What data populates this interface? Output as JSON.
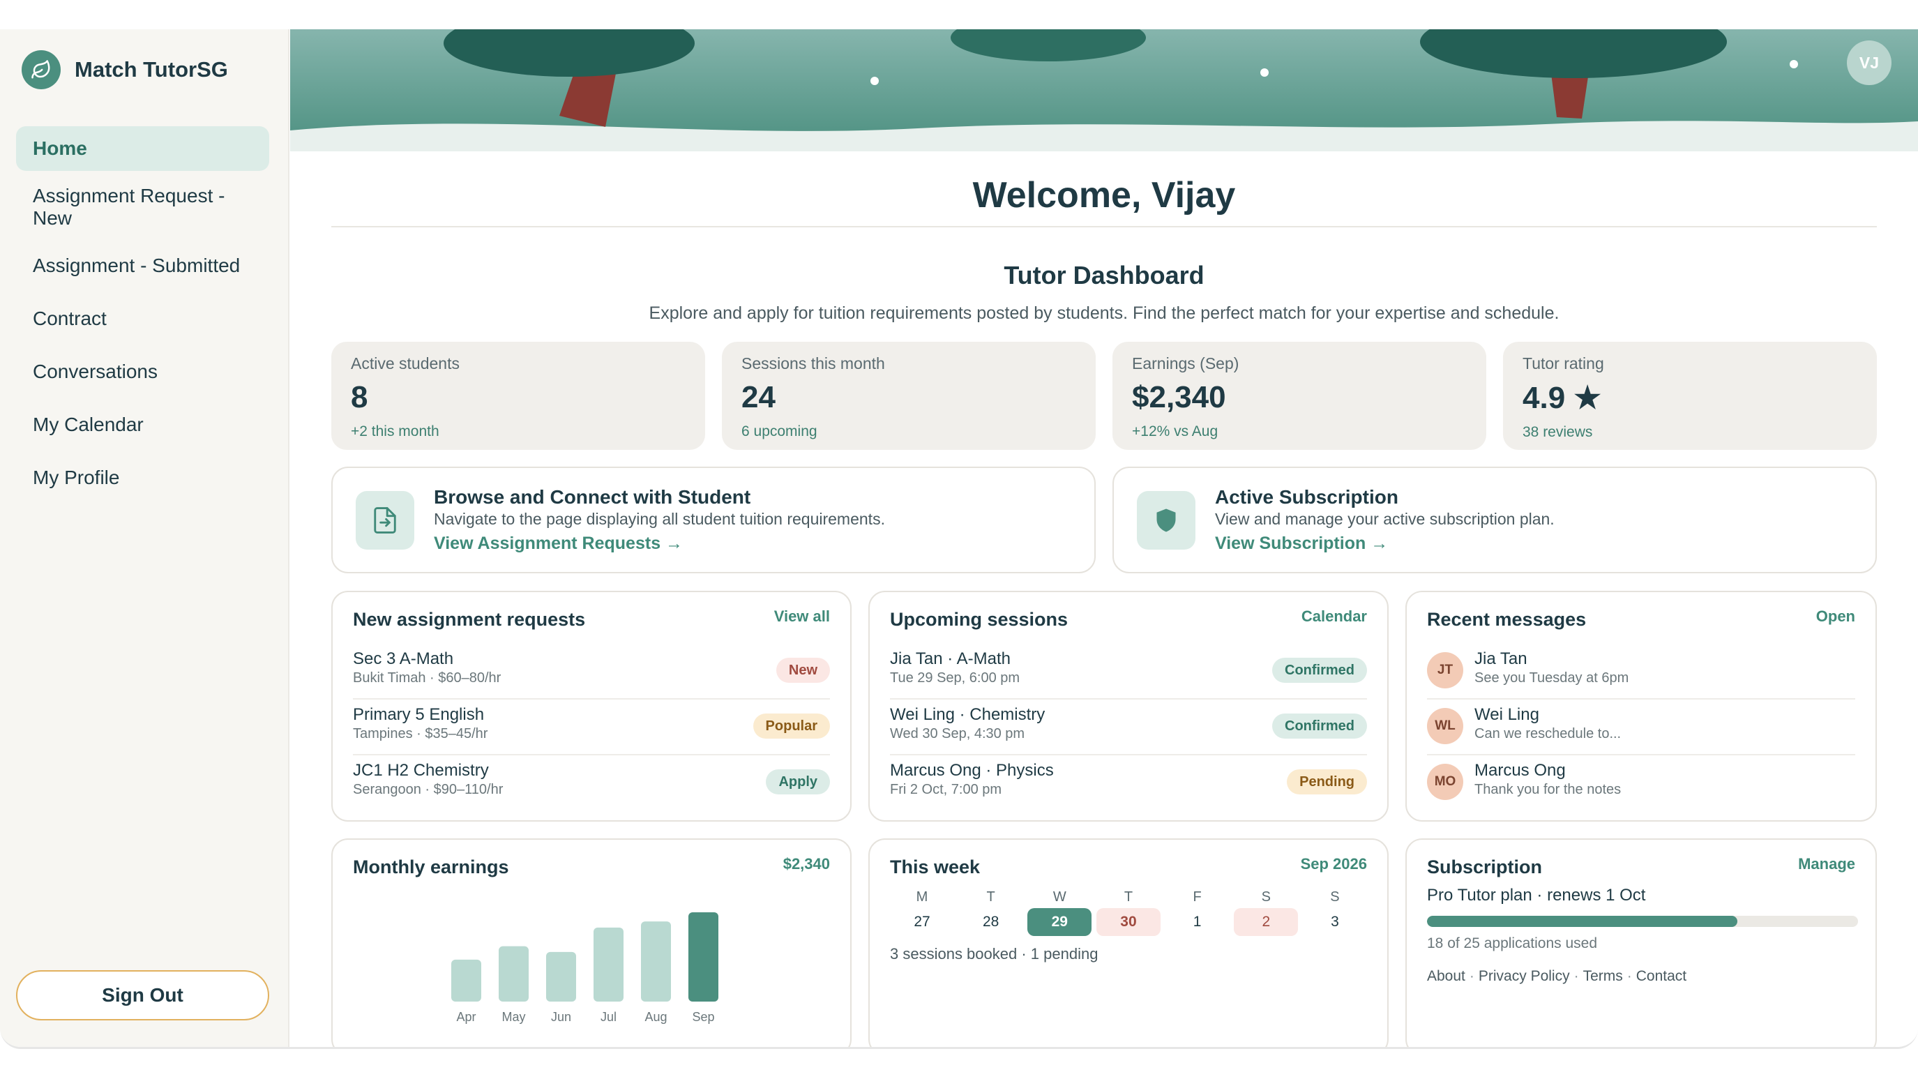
{
  "brand": {
    "name": "Match TutorSG",
    "icon": "leaf-icon"
  },
  "nav": {
    "items": [
      {
        "label": "Home",
        "active": true
      },
      {
        "label": "Assignment Request - New",
        "active": false
      },
      {
        "label": "Assignment - Submitted",
        "active": false
      },
      {
        "label": "Contract",
        "active": false
      },
      {
        "label": "Conversations",
        "active": false
      },
      {
        "label": "My Calendar",
        "active": false
      },
      {
        "label": "My Profile",
        "active": false
      }
    ],
    "sign_out": "Sign Out"
  },
  "user": {
    "initials": "VJ"
  },
  "welcome": "Welcome, Vijay",
  "dashboard": {
    "title": "Tutor Dashboard",
    "subtitle": "Explore and apply for tuition requirements posted by students. Find the perfect match for your expertise and schedule."
  },
  "stats": [
    {
      "label": "Active students",
      "value": "8",
      "note": "+2 this month"
    },
    {
      "label": "Sessions this month",
      "value": "24",
      "note": "6 upcoming"
    },
    {
      "label": "Earnings (Sep)",
      "value": "$2,340",
      "note": "+12% vs Aug"
    },
    {
      "label": "Tutor rating",
      "value": "4.9 ★",
      "note": "38 reviews"
    }
  ],
  "quick": {
    "browse": {
      "title": "Browse and Connect with Student",
      "desc": "Navigate to the page displaying all student tuition requirements.",
      "link": "View Assignment Requests →",
      "icon": "document-import-icon"
    },
    "subscription": {
      "title": "Active Subscription",
      "desc": "View and manage your active subscription plan.",
      "link": "View Subscription →",
      "icon": "shield-icon"
    }
  },
  "requests": {
    "title": "New assignment requests",
    "link": "View all",
    "items": [
      {
        "title": "Sec 3 A-Math",
        "sub": "Bukit Timah · $60–80/hr",
        "badge": "New"
      },
      {
        "title": "Primary 5 English",
        "sub": "Tampines · $35–45/hr",
        "badge": "Popular"
      },
      {
        "title": "JC1 H2 Chemistry",
        "sub": "Serangoon · $90–110/hr",
        "badge": "Apply"
      }
    ]
  },
  "sessions": {
    "title": "Upcoming sessions",
    "link": "Calendar",
    "items": [
      {
        "title": "Jia Tan · A-Math",
        "sub": "Tue 29 Sep, 6:00 pm",
        "badge": "Confirmed"
      },
      {
        "title": "Wei Ling · Chemistry",
        "sub": "Wed 30 Sep, 4:30 pm",
        "badge": "Confirmed"
      },
      {
        "title": "Marcus Ong · Physics",
        "sub": "Fri 2 Oct, 7:00 pm",
        "badge": "Pending"
      }
    ]
  },
  "messages": {
    "title": "Recent messages",
    "link": "Open",
    "items": [
      {
        "initials": "JT",
        "name": "Jia Tan",
        "preview": "See you Tuesday at 6pm"
      },
      {
        "initials": "WL",
        "name": "Wei Ling",
        "preview": "Can we reschedule to..."
      },
      {
        "initials": "MO",
        "name": "Marcus Ong",
        "preview": "Thank you for the notes"
      }
    ]
  },
  "earnings": {
    "title": "Monthly earnings",
    "total": "$2,340"
  },
  "chart_data": {
    "type": "bar",
    "categories": [
      "Apr",
      "May",
      "Jun",
      "Jul",
      "Aug",
      "Sep"
    ],
    "values": [
      1100,
      1450,
      1300,
      1940,
      2100,
      2340
    ],
    "highlight": "Sep",
    "colors": {
      "bar": "#b9d9d1",
      "highlight": "#4b8f7f"
    }
  },
  "week": {
    "title": "This week",
    "month": "Sep 2026",
    "days": [
      "M",
      "T",
      "W",
      "T",
      "F",
      "S",
      "S"
    ],
    "dates": [
      "27",
      "28",
      "29",
      "30",
      "1",
      "2",
      "3"
    ],
    "note": "3 sessions booked · 1 pending"
  },
  "subscription": {
    "title": "Subscription",
    "link": "Manage",
    "plan": "Pro Tutor plan · renews 1 Oct",
    "used": 18,
    "total": 25,
    "usage": "18 of 25 applications used",
    "footer": [
      "About",
      "Privacy Policy",
      "Terms",
      "Contact"
    ]
  },
  "colors": {
    "accent": "#4b8f7f",
    "text": "#1f3a44",
    "stat_bg": "#f1efeb"
  }
}
